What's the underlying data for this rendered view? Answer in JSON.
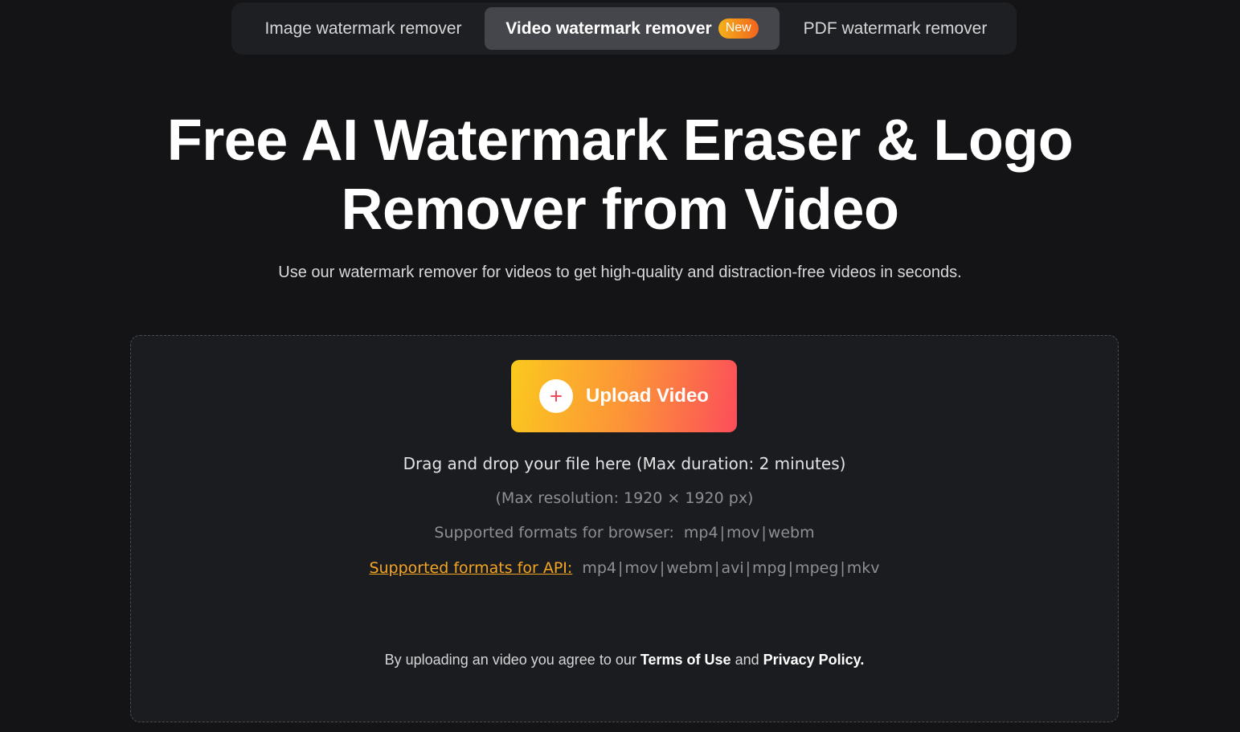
{
  "tabs": [
    {
      "label": "Image watermark remover",
      "active": false
    },
    {
      "label": "Video watermark remover",
      "active": true,
      "badge": "New"
    },
    {
      "label": "PDF watermark remover",
      "active": false
    }
  ],
  "hero": {
    "title_line1": "Free AI Watermark Eraser & Logo",
    "title_line2": "Remover from Video",
    "subtitle": "Use our watermark remover for videos to get high-quality and distraction-free videos in seconds."
  },
  "upload": {
    "button_label": "Upload Video",
    "button_icon": "plus-icon",
    "drag_text": "Drag and drop your file here (Max duration: 2 minutes)",
    "resolution_text": "(Max resolution: 1920 × 1920 px)",
    "browser_formats_label": "Supported formats for browser:",
    "browser_formats": [
      "mp4",
      "mov",
      "webm"
    ],
    "api_formats_label": "Supported formats for API:",
    "api_formats": [
      "mp4",
      "mov",
      "webm",
      "avi",
      "mpg",
      "mpeg",
      "mkv"
    ]
  },
  "terms": {
    "prefix": "By uploading an video you agree to our ",
    "terms_link": "Terms of Use",
    "middle": " and ",
    "privacy_link": "Privacy Policy."
  },
  "colors": {
    "background": "#141416",
    "accent_orange": "#f5a524",
    "button_gradient_start": "#fbc91e",
    "button_gradient_end": "#fc4d5a",
    "badge_gradient_start": "#f5b21a",
    "badge_gradient_end": "#f2641d"
  }
}
